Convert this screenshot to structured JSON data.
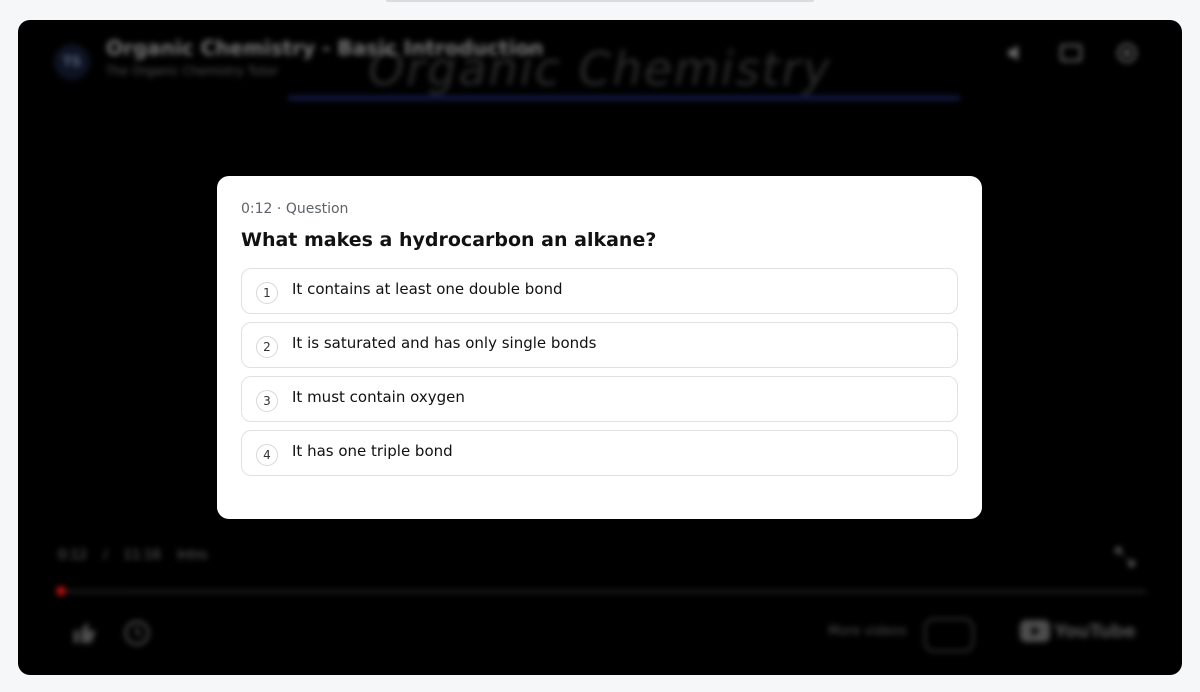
{
  "video": {
    "channel_avatar_text": "TS",
    "title": "Organic Chemistry - Basic Introduction",
    "channel": "The Organic Chemistry Tutor",
    "board_title": "Organic Chemistry"
  },
  "controls": {
    "time_current": "0:12",
    "time_separator": "/",
    "time_total": "11:16",
    "chapter": "Intro",
    "more_videos_label": "More videos",
    "youtube_logo_text": "YouTube",
    "progress_fraction": 0.002
  },
  "quiz": {
    "timestamp": "0:12",
    "meta_separator": "·",
    "meta_label": "Question",
    "question": "What makes a hydrocarbon an alkane?",
    "options": [
      {
        "num": "1",
        "text": "It contains at least one double bond"
      },
      {
        "num": "2",
        "text": "It is saturated and has only single bonds"
      },
      {
        "num": "3",
        "text": "It must contain oxygen"
      },
      {
        "num": "4",
        "text": "It has one triple bond"
      }
    ]
  },
  "colors": {
    "player_bg": "#000000",
    "card_bg": "#ffffff",
    "progress": "#ee1111",
    "board_underline": "#25308f"
  }
}
